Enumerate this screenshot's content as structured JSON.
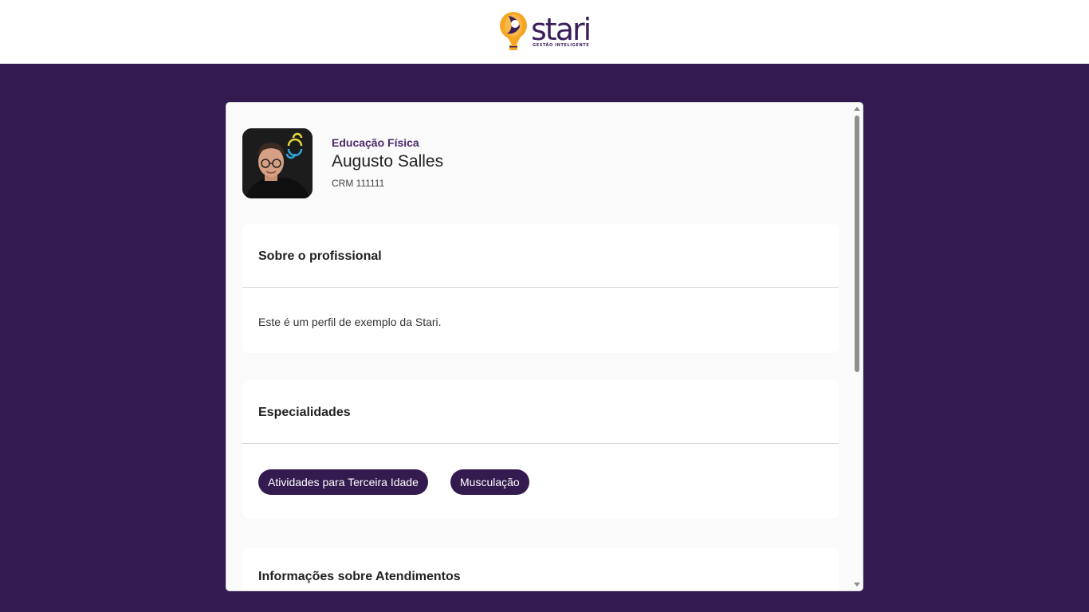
{
  "header": {
    "logo_text": "stari",
    "logo_tagline": "GESTÃO INTELIGENTE"
  },
  "profile": {
    "profession": "Educação Física",
    "name": "Augusto Salles",
    "crm": "CRM 111111"
  },
  "sections": {
    "about": {
      "title": "Sobre o profissional",
      "text": "Este é um perfil de exemplo da Stari."
    },
    "specialties": {
      "title": "Especialidades",
      "items": [
        "Atividades para Terceira Idade",
        "Musculação"
      ]
    },
    "appointments": {
      "title": "Informações sobre Atendimentos"
    }
  },
  "colors": {
    "background": "#331a4f",
    "chip": "#331a4f",
    "logo_orange": "#f5a623"
  }
}
